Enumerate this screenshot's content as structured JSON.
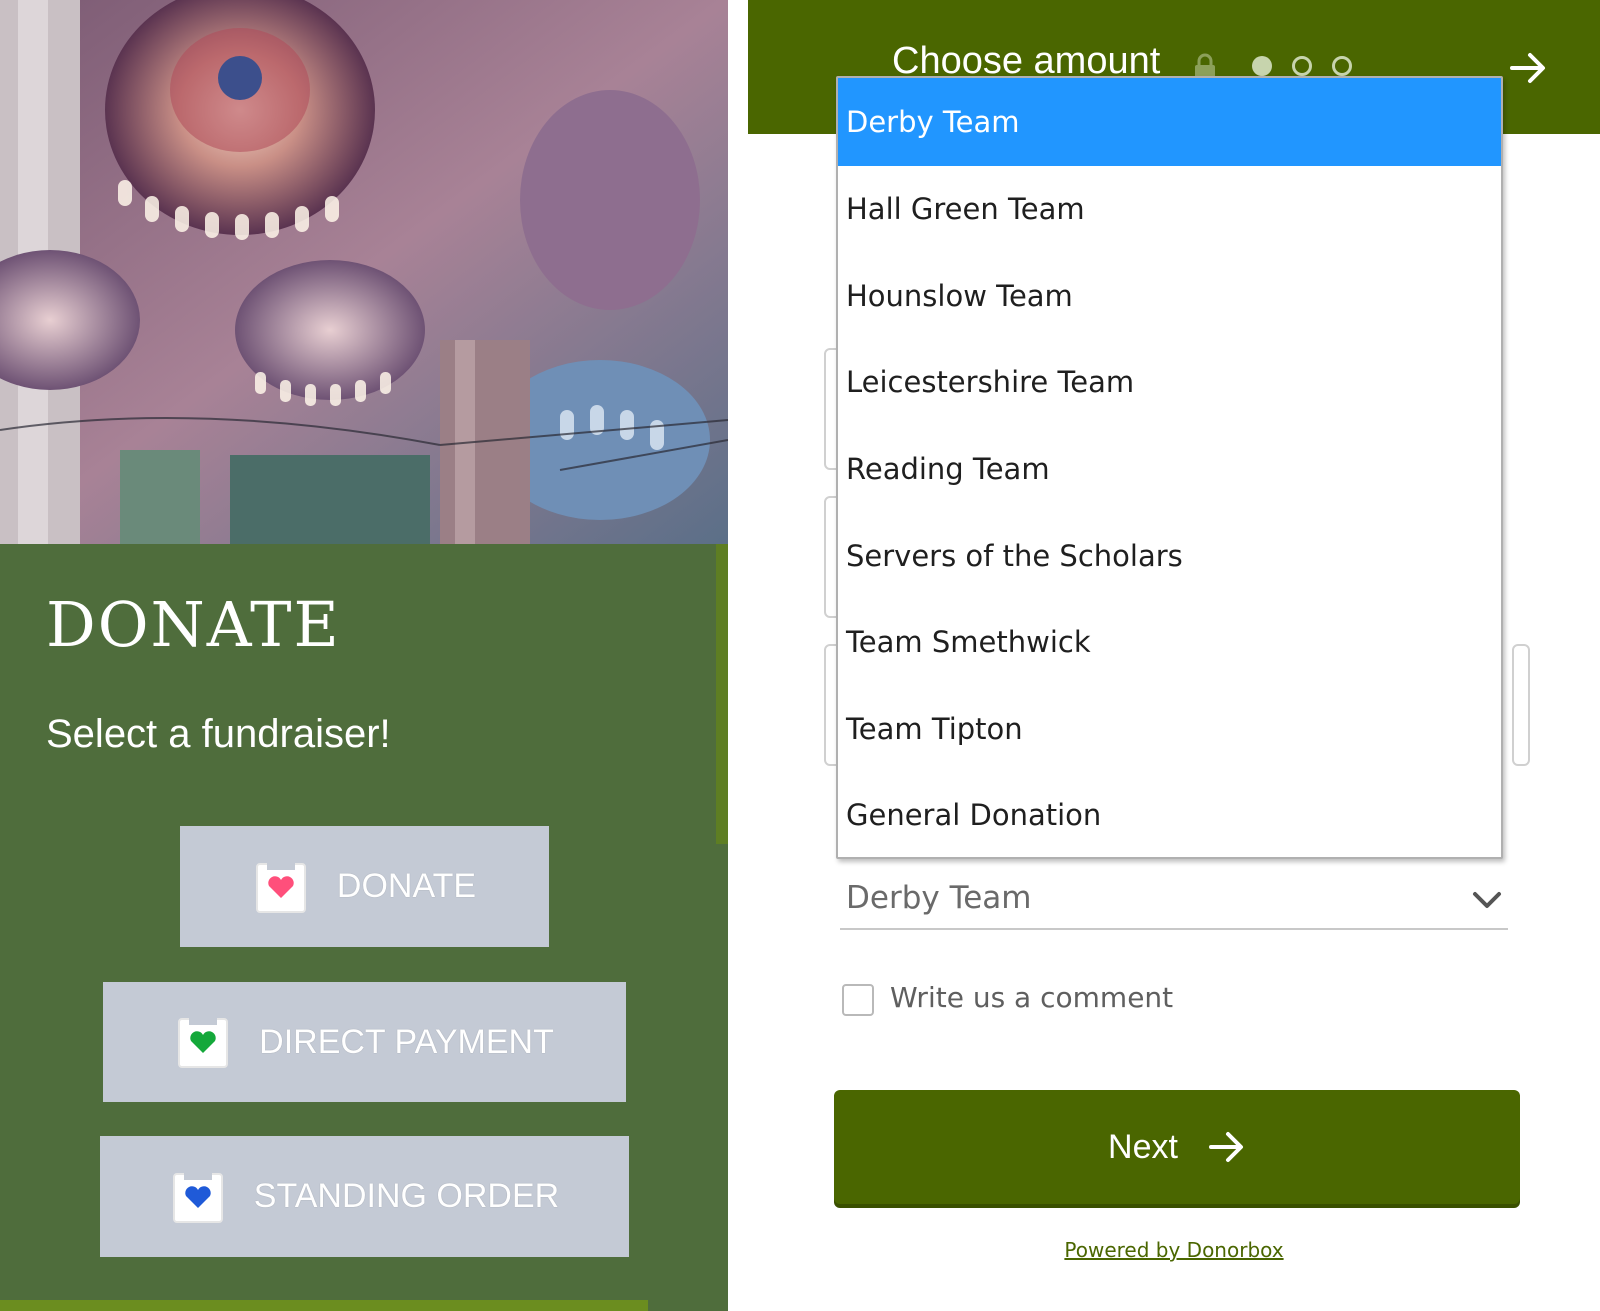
{
  "left_panel": {
    "title": "DONATE",
    "subtitle": "Select a fundraiser!",
    "buttons": [
      {
        "label": "DONATE",
        "heart_color": "#ff4f7b"
      },
      {
        "label": "DIRECT PAYMENT",
        "heart_color": "#14a83a"
      },
      {
        "label": "STANDING ORDER",
        "heart_color": "#1f5ad8"
      }
    ]
  },
  "form": {
    "step_title": "Choose amount",
    "steps_total": 3,
    "current_step": 1,
    "dropdown": {
      "options": [
        "Derby Team",
        "Hall Green Team",
        "Hounslow Team",
        "Leicestershire Team",
        "Reading Team",
        "Servers of the Scholars",
        "Team Smethwick",
        "Team Tipton",
        "General Donation"
      ],
      "highlighted": "Derby Team"
    },
    "selected_value": "Derby Team",
    "comment_label": "Write us a comment",
    "comment_checked": false,
    "next_label": "Next",
    "powered_by": "Powered by Donorbox"
  },
  "colors": {
    "brand_green": "#4a6600",
    "panel_green": "#4f6d3c",
    "highlight_blue": "#2196ff",
    "button_gray": "#c4cad5"
  }
}
